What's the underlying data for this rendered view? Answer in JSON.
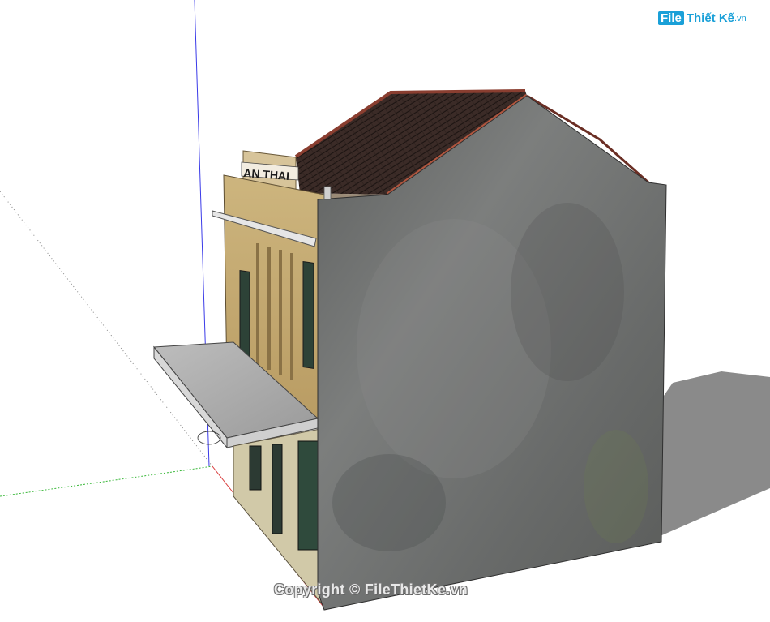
{
  "app": {
    "viewport_label": "3D model viewport"
  },
  "logo": {
    "badge": "File",
    "text": "Thiết Kế",
    "suffix": ".vn"
  },
  "sign": {
    "text": "AN THAI"
  },
  "watermark": {
    "text": "Copyright © FileThietKe.vn"
  },
  "colors": {
    "axis_blue": "#3a3ae8",
    "axis_red": "#d83a3a",
    "axis_green": "#3ab83a",
    "wall": "#6f7170",
    "facade": "#c7ad74",
    "roof": "#3a2a26",
    "shadow": "#8a8a8a"
  }
}
